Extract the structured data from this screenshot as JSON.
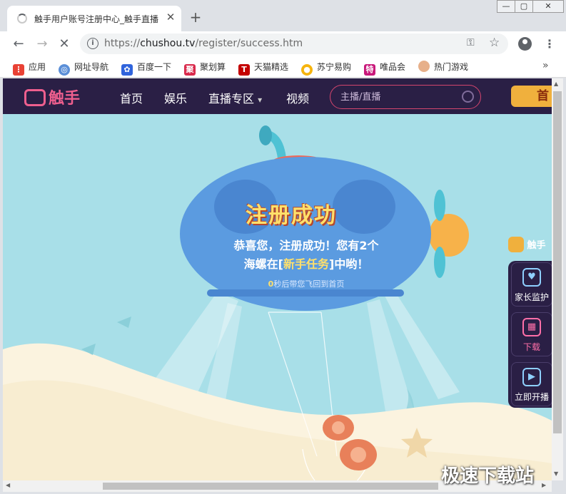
{
  "browser": {
    "tab_title": "触手用户账号注册中心_触手直播",
    "tab_close": "✕",
    "new_tab": "+",
    "window_controls": {
      "minimize": "—",
      "restore": "▢",
      "close": "✕"
    },
    "url_prefix": "https://",
    "url_domain": "chushou.tv",
    "url_path": "/register/success.htm",
    "nav": {
      "back": "←",
      "forward": "→",
      "stop": "✕"
    },
    "omnibox_key": "⚿",
    "omnibox_star": "☆",
    "menu": "⋮",
    "bookmarks": [
      {
        "label": "应用",
        "icon": "apps-icon",
        "color": "#e94235"
      },
      {
        "label": "网址导航",
        "icon": "globe-icon",
        "color": "#5b8fd8"
      },
      {
        "label": "百度一下",
        "icon": "baidu-paw-icon",
        "color": "#3064dc"
      },
      {
        "label": "聚划算",
        "icon": "juhuasuan-icon",
        "color": "#d92a4c"
      },
      {
        "label": "天猫精选",
        "icon": "tmall-icon",
        "color": "#c40000"
      },
      {
        "label": "苏宁易购",
        "icon": "suning-icon",
        "color": "#f6b40e"
      },
      {
        "label": "唯品会",
        "icon": "vip-icon",
        "color": "#c8187a"
      },
      {
        "label": "热门游戏",
        "icon": "game-avatar-icon",
        "color": "#e7b08a"
      }
    ],
    "bookmarks_more": "»"
  },
  "site": {
    "logo_text": "触手",
    "nav_items": [
      "首页",
      "娱乐",
      "直播专区",
      "视频"
    ],
    "nav_dropdown_arrow": "▾",
    "search_placeholder": "主播/直播",
    "home_button": "首",
    "success_title": "注册成功",
    "congrats_line1_a": "恭喜您，注册成功！您有2个",
    "congrats_line2_a": "海螺在[",
    "congrats_highlight": "新手任务",
    "congrats_line2_b": "]中哟！",
    "countdown_num": "0",
    "countdown_text": "秒后带您飞回到首页",
    "side_logo": "触手",
    "side_buttons": [
      {
        "label": "家长监护",
        "glyph": "♥"
      },
      {
        "label": "下载",
        "glyph": "▦"
      },
      {
        "label": "立即开播",
        "glyph": "▶"
      }
    ]
  },
  "watermark": "极速下载站",
  "colors": {
    "site_nav_bg": "#2a1f45",
    "accent_pink": "#ef5f8e",
    "sky": "#a8dfe8",
    "submarine": "#5b9be0",
    "title_yellow": "#ffe06b"
  }
}
